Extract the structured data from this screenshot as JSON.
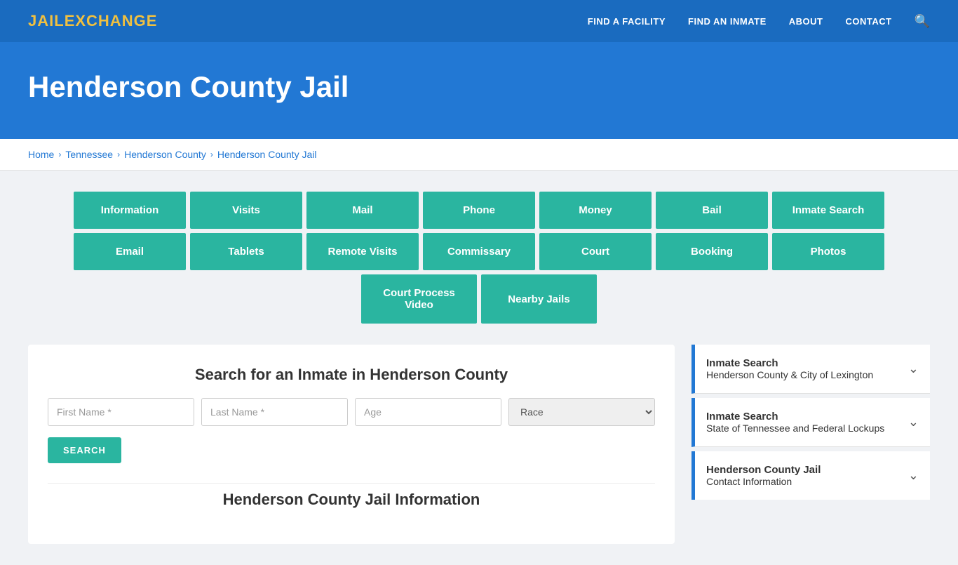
{
  "header": {
    "logo_jail": "JAIL",
    "logo_exchange": "EXCHANGE",
    "nav": [
      {
        "label": "FIND A FACILITY",
        "id": "find-facility"
      },
      {
        "label": "FIND AN INMATE",
        "id": "find-inmate"
      },
      {
        "label": "ABOUT",
        "id": "about"
      },
      {
        "label": "CONTACT",
        "id": "contact"
      }
    ]
  },
  "hero": {
    "title": "Henderson County Jail"
  },
  "breadcrumb": {
    "items": [
      {
        "label": "Home"
      },
      {
        "label": "Tennessee"
      },
      {
        "label": "Henderson County"
      },
      {
        "label": "Henderson County Jail"
      }
    ]
  },
  "buttons_row1": [
    {
      "label": "Information"
    },
    {
      "label": "Visits"
    },
    {
      "label": "Mail"
    },
    {
      "label": "Phone"
    },
    {
      "label": "Money"
    },
    {
      "label": "Bail"
    },
    {
      "label": "Inmate Search"
    }
  ],
  "buttons_row2": [
    {
      "label": "Email"
    },
    {
      "label": "Tablets"
    },
    {
      "label": "Remote Visits"
    },
    {
      "label": "Commissary"
    },
    {
      "label": "Court"
    },
    {
      "label": "Booking"
    },
    {
      "label": "Photos"
    }
  ],
  "buttons_row3": [
    {
      "label": "Court Process Video"
    },
    {
      "label": "Nearby Jails"
    }
  ],
  "search": {
    "heading": "Search for an Inmate in Henderson County",
    "first_name_placeholder": "First Name *",
    "last_name_placeholder": "Last Name *",
    "age_placeholder": "Age",
    "race_placeholder": "Race",
    "search_btn_label": "SEARCH"
  },
  "jail_info_heading": "Henderson County Jail Information",
  "sidebar": {
    "cards": [
      {
        "main_title": "Inmate Search",
        "sub_title": "Henderson County & City of Lexington",
        "highlighted": true
      },
      {
        "main_title": "Inmate Search",
        "sub_title": "State of Tennessee and Federal Lockups",
        "highlighted": false
      },
      {
        "main_title": "Henderson County Jail",
        "sub_title": "Contact Information",
        "highlighted": false
      }
    ]
  }
}
